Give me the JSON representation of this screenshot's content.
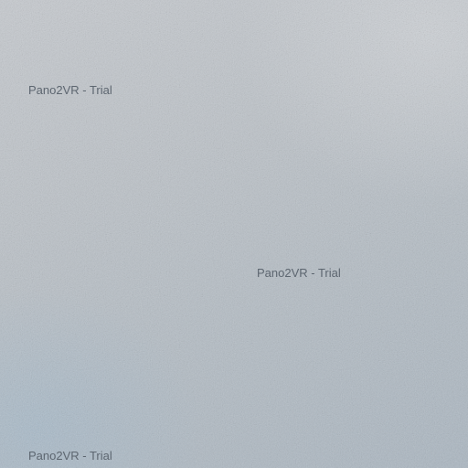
{
  "panorama": {
    "watermarks": [
      "Pano2VR - Trial",
      "Pano2VR - Trial",
      "Pano2VR - Trial"
    ]
  }
}
